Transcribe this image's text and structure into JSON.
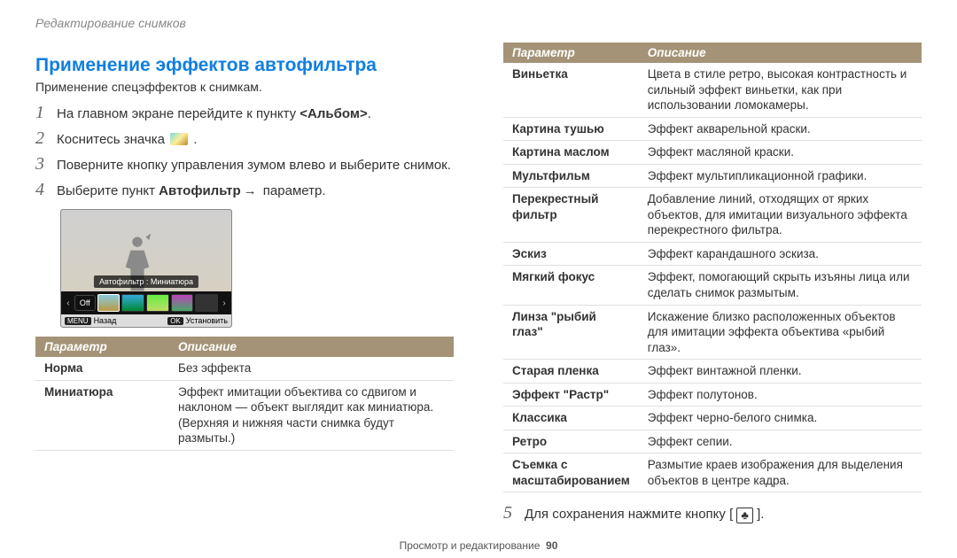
{
  "breadcrumb": "Редактирование снимков",
  "heading": "Применение эффектов автофильтра",
  "subtext": "Применение спецэффектов к снимкам.",
  "steps": {
    "s1_pre": "На главном экране перейдите к пункту ",
    "s1_bold": "<Альбом>",
    "s1_post": ".",
    "s2_pre": "Коснитесь значка ",
    "s2_post": " .",
    "s3": "Поверните кнопку управления зумом влево и выберите снимок.",
    "s4_pre": "Выберите пункт ",
    "s4_bold": "Автофильтр",
    "s4_post": " параметр.",
    "s5": "Для сохранения нажмите кнопку [ "
  },
  "step_numbers": {
    "n1": "1",
    "n2": "2",
    "n3": "3",
    "n4": "4",
    "n5": "5"
  },
  "arrow": "→",
  "preview": {
    "tooltip": "Автофильтр : Миниатюра",
    "off": "Off",
    "menu_key": "MENU",
    "menu_label": "Назад",
    "ok_key": "OK",
    "ok_label": "Установить"
  },
  "table_headers": {
    "param": "Параметр",
    "desc": "Описание"
  },
  "left_rows": [
    {
      "param": "Норма",
      "desc": "Без эффекта"
    },
    {
      "param": "Миниатюра",
      "desc": "Эффект имитации объектива со сдвигом и наклоном — объект выглядит как миниатюра. (Верхняя и нижняя части снимка будут размыты.)"
    }
  ],
  "right_rows": [
    {
      "param": "Виньетка",
      "desc": "Цвета в стиле ретро, высокая контрастность и сильный эффект виньетки, как при использовании ломокамеры."
    },
    {
      "param": "Картина тушью",
      "desc": "Эффект акварельной краски."
    },
    {
      "param": "Картина маслом",
      "desc": "Эффект масляной краски."
    },
    {
      "param": "Мультфильм",
      "desc": "Эффект мультипликационной графики."
    },
    {
      "param": "Перекрестный фильтр",
      "desc": "Добавление линий, отходящих от ярких объектов, для имитации визуального эффекта перекрестного фильтра."
    },
    {
      "param": "Эскиз",
      "desc": "Эффект карандашного эскиза."
    },
    {
      "param": "Мягкий фокус",
      "desc": "Эффект, помогающий скрыть изъяны лица или сделать снимок размытым."
    },
    {
      "param": "Линза \"рыбий глаз\"",
      "desc": "Искажение близко расположенных объектов для имитации эффекта объектива «рыбий глаз»."
    },
    {
      "param": "Старая пленка",
      "desc": "Эффект винтажной пленки."
    },
    {
      "param": "Эффект \"Растр\"",
      "desc": "Эффект полутонов."
    },
    {
      "param": "Классика",
      "desc": "Эффект черно-белого снимка."
    },
    {
      "param": "Ретро",
      "desc": "Эффект сепии."
    },
    {
      "param": "Съемка с масштабированием",
      "desc": "Размытие краев изображения для выделения объектов в центре кадра."
    }
  ],
  "save_suffix": " ].",
  "footer": {
    "section": "Просмотр и редактирование",
    "page": "90"
  },
  "icons": {
    "save": "♣"
  }
}
